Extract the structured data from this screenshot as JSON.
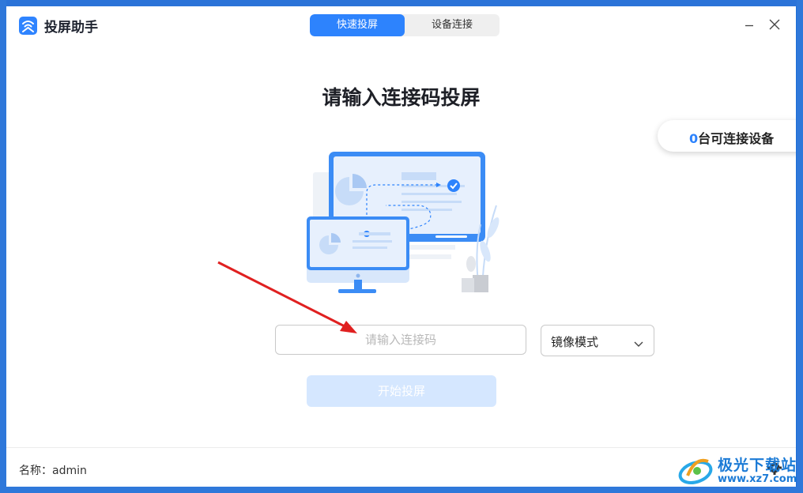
{
  "app": {
    "title": "投屏助手"
  },
  "tabs": [
    {
      "label": "快速投屏",
      "active": true
    },
    {
      "label": "设备连接",
      "active": false
    }
  ],
  "main": {
    "heading": "请输入连接码投屏",
    "device_count": {
      "number": "0",
      "suffix": "台可连接设备"
    },
    "code_input": {
      "value": "",
      "placeholder": "请输入连接码"
    },
    "mode_select": {
      "selected": "镜像模式"
    },
    "start_button": "开始投屏"
  },
  "footer": {
    "name": "名称：admin"
  },
  "watermark": {
    "title": "极光下载站",
    "url": "www.xz7.com"
  },
  "colors": {
    "accent": "#2d83fd",
    "arrow": "#e02020",
    "disabled_button": "#d5e7ff"
  },
  "icons": [
    "app-logo-icon",
    "minimize-icon",
    "close-icon",
    "chevron-down-icon",
    "gear-icon"
  ]
}
